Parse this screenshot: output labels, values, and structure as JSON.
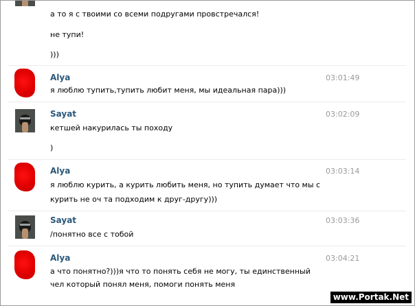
{
  "messages": [
    {
      "author": "",
      "avatar": "hooded",
      "time": "",
      "lines": [
        "а то я с твоими со всеми подругами провстречался!",
        "не тупи!",
        ")))"
      ]
    },
    {
      "author": "Alya",
      "avatar": "red",
      "time": "03:01:49",
      "lines": [
        "я люблю тупить,тупить любит меня, мы идеальная пара)))"
      ]
    },
    {
      "author": "Sayat",
      "avatar": "hooded",
      "time": "03:02:09",
      "lines": [
        "кетшей накурилась ты походу",
        ")"
      ]
    },
    {
      "author": "Alya",
      "avatar": "red",
      "time": "03:03:14",
      "lines": [
        "я люблю курить, а курить любить меня, но тупить думает что мы с",
        "курить не оч та подходим к друг-другу)))"
      ]
    },
    {
      "author": "Sayat",
      "avatar": "hooded",
      "time": "03:03:36",
      "lines": [
        "/понятно все с тобой"
      ]
    },
    {
      "author": "Alya",
      "avatar": "red",
      "time": "03:04:21",
      "lines": [
        "а что понятно?)))я что то понять себя не могу, ты единственный",
        "чел который понял меня, помоги понять меня"
      ]
    }
  ],
  "watermark": "www.Portak.Net"
}
